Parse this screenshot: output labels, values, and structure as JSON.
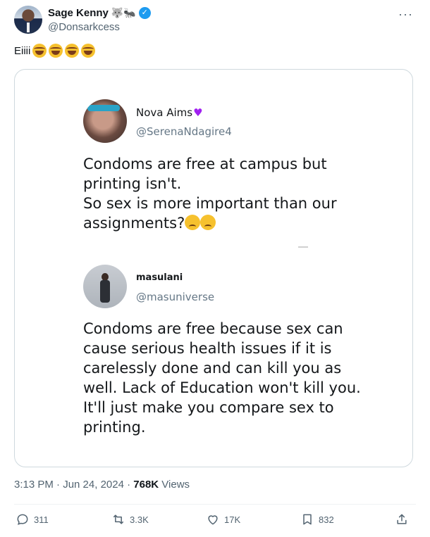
{
  "author": {
    "display_name": "Sage Kenny",
    "name_emojis": "🐺🐜",
    "verified_mark": "✓",
    "handle": "@Donsarkcess",
    "more_menu": "···"
  },
  "post": {
    "text": "Eiiii"
  },
  "screenshot": {
    "first_reply": {
      "name": "Nova Aims",
      "name_emoji": "♥",
      "handle": "@SerenaNdagire4",
      "lines": [
        "Condoms are free at campus but",
        "printing isn't.",
        "So sex is more important than our",
        "assignments?"
      ]
    },
    "second_reply": {
      "name": "masulani",
      "handle": "@masuniverse",
      "lines": [
        "Condoms are free because sex can",
        "cause serious health issues if it is",
        "carelessly done and can kill you as",
        "well. Lack of Education won't kill you.",
        "It'll just make you compare sex to",
        "printing."
      ]
    }
  },
  "meta": {
    "time": "3:13 PM · Jun 24, 2024 · ",
    "views_count": "768K",
    "views_label": " Views"
  },
  "actions": {
    "replies": "311",
    "reposts": "3.3K",
    "likes": "17K",
    "bookmarks": "832"
  },
  "colors": {
    "accent": "#1d9bf0",
    "secondary_text": "#536471"
  }
}
